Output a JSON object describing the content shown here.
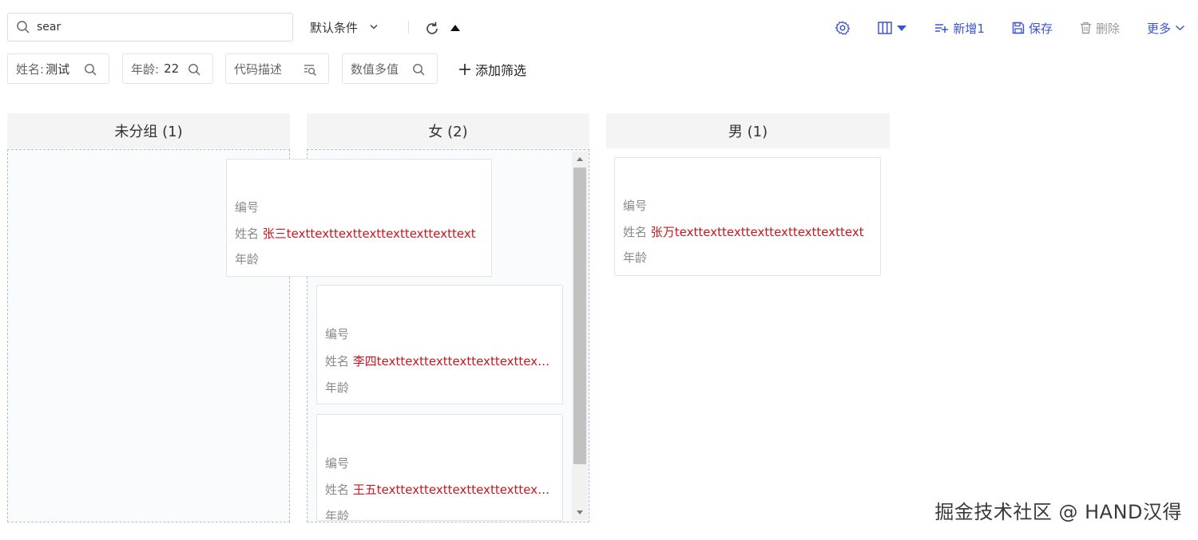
{
  "toolbar": {
    "search_value": "sear",
    "condition_select": "默认条件",
    "actions": {
      "view_toggle": "▥",
      "add_label": "新增1",
      "save_label": "保存",
      "delete_label": "删除",
      "more_label": "更多"
    }
  },
  "filters": [
    {
      "label": "姓名:",
      "value": "测试"
    },
    {
      "label": "年龄:",
      "value": "22"
    },
    {
      "label": "代码描述",
      "value": ""
    },
    {
      "label": "数值多值",
      "value": ""
    }
  ],
  "add_filter_label": "添加筛选",
  "columns": [
    {
      "title": "未分组 (1)"
    },
    {
      "title": "女 (2)"
    },
    {
      "title": "男 (1)"
    }
  ],
  "field_labels": {
    "code": "编号",
    "name": "姓名",
    "age": "年龄"
  },
  "cards": [
    {
      "name": "张三texttexttexttexttexttexttexttext"
    },
    {
      "name": "李四texttexttexttexttexttexttexttext"
    },
    {
      "name": "王五texttexttexttexttexttexttexttext"
    },
    {
      "name": "张万texttexttexttexttexttexttexttext"
    }
  ],
  "watermark": "掘金技术社区 @ HAND汉得",
  "colors": {
    "accent": "#3b53d4",
    "name_red": "#c6171d",
    "dash_border": "#aebee2"
  }
}
